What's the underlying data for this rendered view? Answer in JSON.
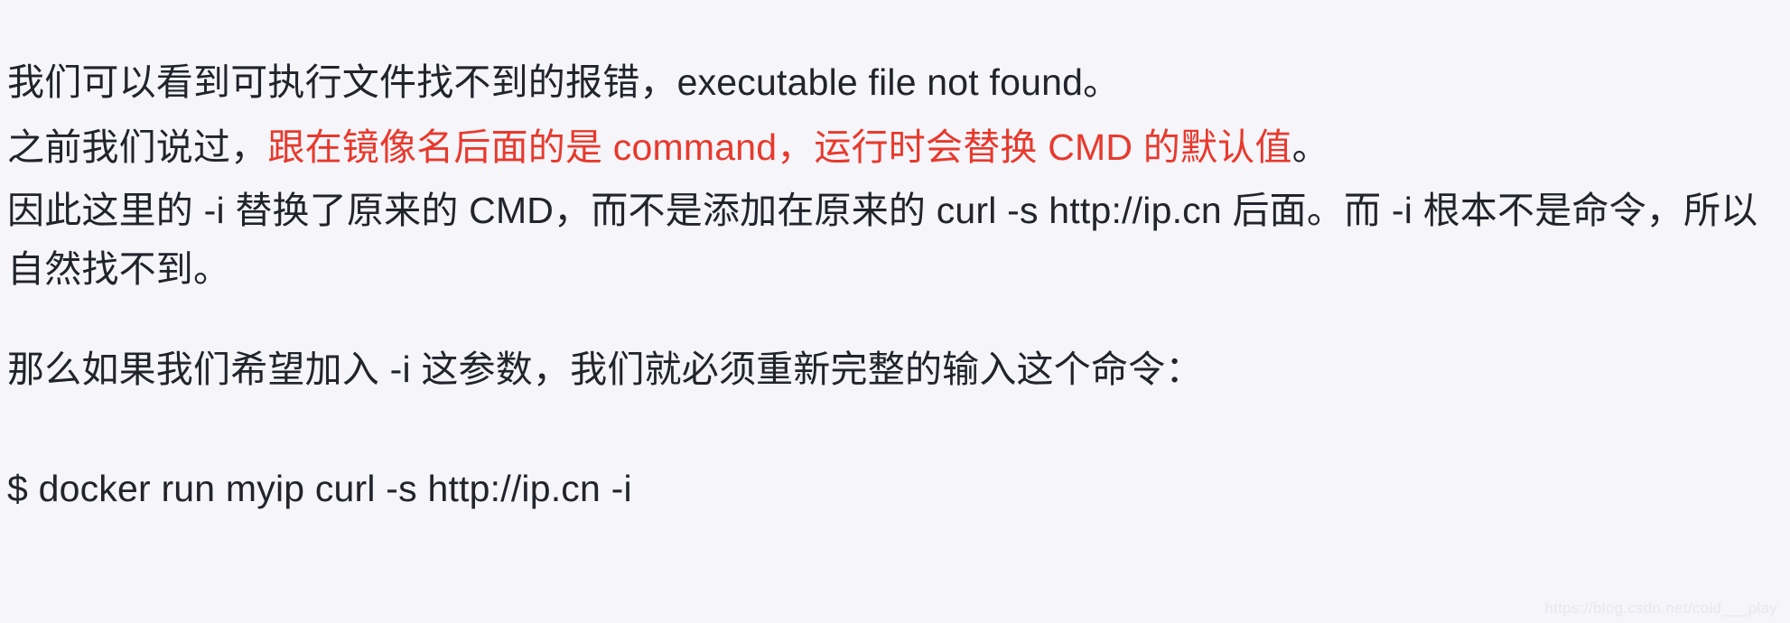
{
  "page": {
    "background_color": "#f5f5fa",
    "text_color": "#22242c",
    "accent_color": "#e8392c"
  },
  "paragraphs": {
    "p1": "我们可以看到可执行文件找不到的报错，executable file not found。",
    "p2_prefix": "之前我们说过，",
    "p2_highlight": "跟在镜像名后面的是 command，运行时会替换 CMD 的默认值",
    "p2_suffix": "。",
    "p3": "因此这里的 -i 替换了原来的 CMD，而不是添加在原来的 curl -s http://ip.cn 后面。而 -i 根本不是命令，所以自然找不到。",
    "p4": "那么如果我们希望加入 -i 这参数，我们就必须重新完整的输入这个命令："
  },
  "command": {
    "text": "$ docker run myip curl -s http://ip.cn -i"
  },
  "watermark": {
    "text": "https://blog.csdn.net/cold___play"
  }
}
